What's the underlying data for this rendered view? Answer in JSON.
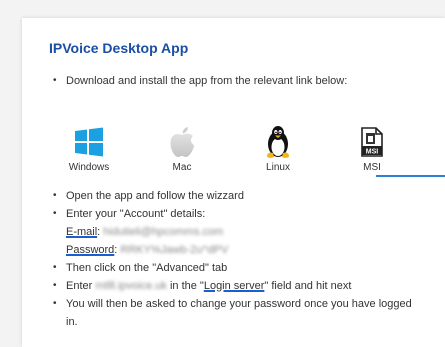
{
  "title": "IPVoice Desktop App",
  "step_download": "Download and install the app from the relevant link below:",
  "downloads": [
    {
      "label": "Windows",
      "icon": "windows-icon"
    },
    {
      "label": "Mac",
      "icon": "apple-icon"
    },
    {
      "label": "Linux",
      "icon": "linux-penguin-icon"
    },
    {
      "label": "MSI",
      "icon": "msi-file-icon"
    }
  ],
  "steps": {
    "open": "Open the app and follow the wizzard",
    "account": "Enter your \"Account\" details:",
    "email_label": "E-mail",
    "email_value": "hidutieli@hpcomms.com",
    "password_label": "Password",
    "password_value": "RRKY%Jawb-2u^dPV",
    "advanced": "Then click on the \"Advanced\" tab",
    "enter_prefix": "Enter",
    "server_value": "mtlll.ipvoice.uk",
    "enter_mid": "in the \"",
    "login_server": "Login server",
    "enter_suffix": "\" field and hit next",
    "password_change": "You will then be asked to change your password once you have logged in."
  },
  "colors": {
    "title": "#1a4fa3",
    "accent": "#2d7fd2",
    "windows": "#1ba1e2"
  }
}
